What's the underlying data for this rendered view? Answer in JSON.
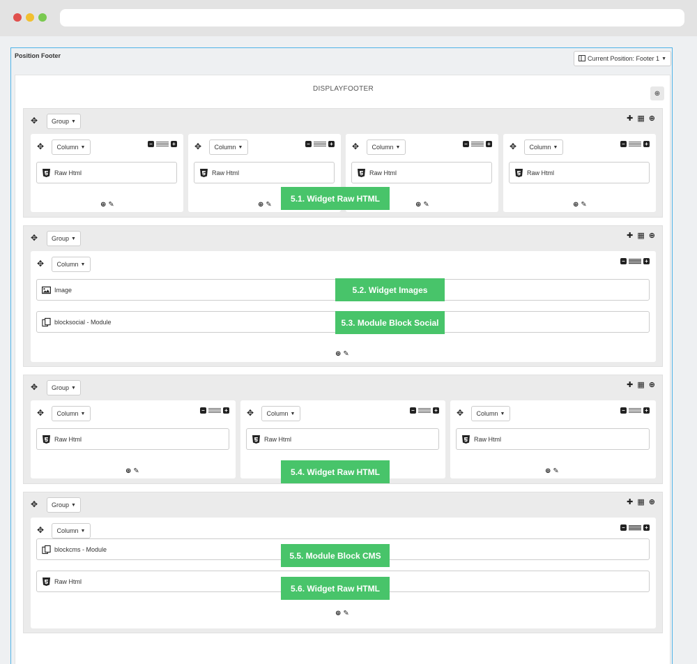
{
  "panel": {
    "title": "Position Footer"
  },
  "current_position": {
    "label": "Current Position: Footer 1"
  },
  "hook": {
    "title": "DISPLAYFOOTER"
  },
  "labels": {
    "group": "Group",
    "column": "Column"
  },
  "widgets": {
    "raw_html": "Raw Html",
    "image": "Image",
    "blocksocial": "blocksocial - Module",
    "blockcms": "blockcms - Module"
  },
  "callouts": {
    "c1": "5.1. Widget Raw HTML",
    "c2": "5.2. Widget Images",
    "c3": "5.3. Module Block Social",
    "c4": "5.4. Widget Raw HTML",
    "c5": "5.5. Module Block CMS",
    "c6": "5.6. Widget Raw HTML"
  },
  "icons": [
    "move-icon",
    "plus-icon",
    "grid-icon",
    "circle-arrow-icon",
    "minus-icon",
    "width-bars-icon",
    "html5-icon",
    "image-icon",
    "module-icon",
    "pencil-icon",
    "layout-icon"
  ]
}
